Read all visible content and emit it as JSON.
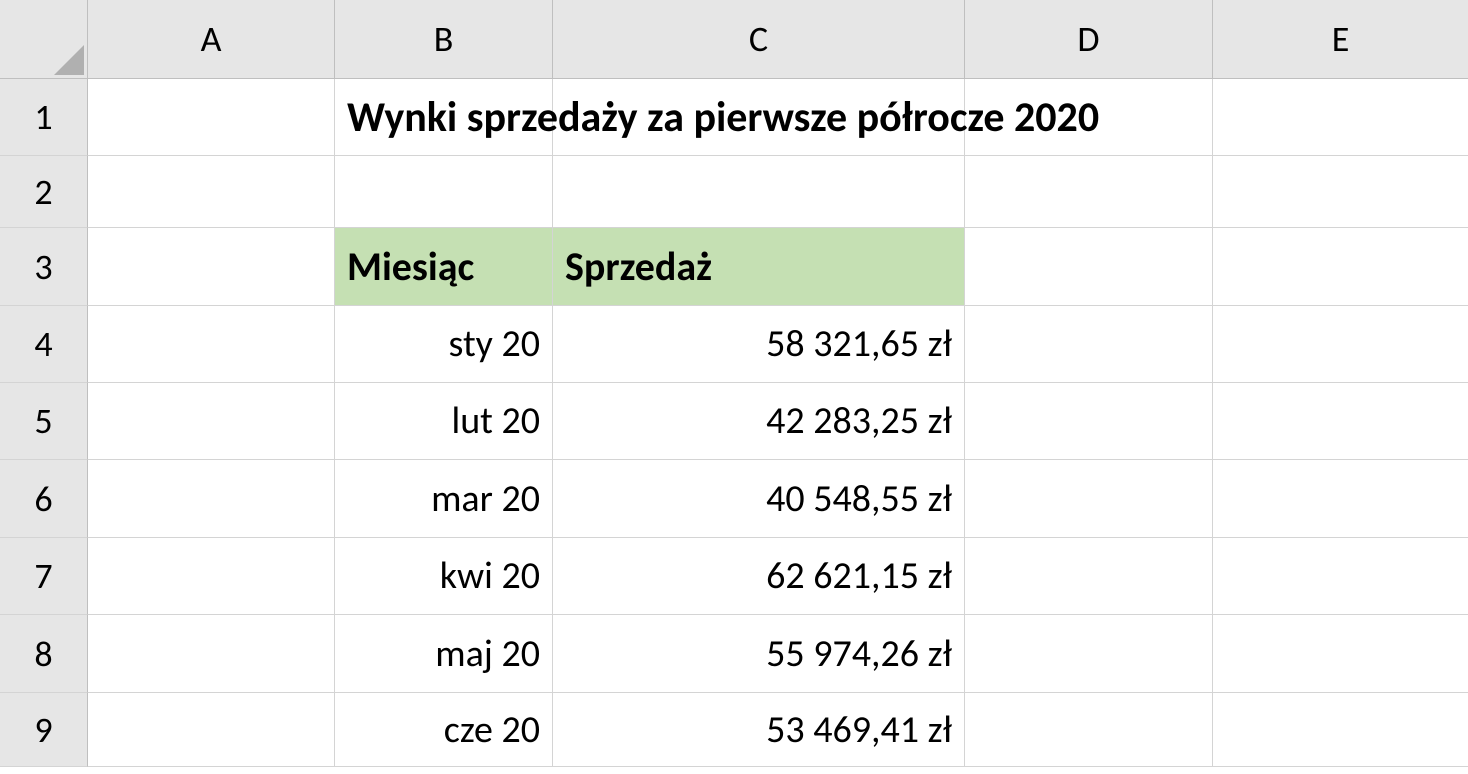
{
  "columns": [
    "A",
    "B",
    "C",
    "D",
    "E"
  ],
  "rows": [
    "1",
    "2",
    "3",
    "4",
    "5",
    "6",
    "7",
    "8",
    "9"
  ],
  "title": "Wynki sprzedaży za pierwsze półrocze 2020",
  "headers": {
    "month": "Miesiąc",
    "sales": "Sprzedaż"
  },
  "data": [
    {
      "month": "sty 20",
      "sales": "58 321,65 zł"
    },
    {
      "month": "lut 20",
      "sales": "42 283,25 zł"
    },
    {
      "month": "mar 20",
      "sales": "40 548,55 zł"
    },
    {
      "month": "kwi 20",
      "sales": "62 621,15 zł"
    },
    {
      "month": "maj 20",
      "sales": "55 974,26 zł"
    },
    {
      "month": "cze 20",
      "sales": "53 469,41 zł"
    }
  ]
}
